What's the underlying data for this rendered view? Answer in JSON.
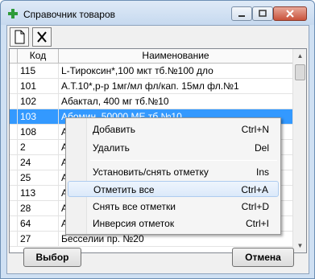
{
  "window": {
    "title": "Справочник товаров"
  },
  "toolbar": {
    "new_icon": "new-document-icon",
    "delete_icon": "delete-x-icon"
  },
  "grid": {
    "columns": [
      "Код",
      "Наименование"
    ],
    "rows": [
      {
        "code": "115",
        "name": "L-Тироксин*,100 мкт тб.№100 дло",
        "selected": false
      },
      {
        "code": "101",
        "name": "А.Т.10*,р-р 1мг/мл фл/кап. 15мл фл.№1",
        "selected": false
      },
      {
        "code": "102",
        "name": "Абактал, 400 мг тб.№10",
        "selected": false
      },
      {
        "code": "103",
        "name": "Абомин, 50000 МЕ тб.№10",
        "selected": true
      },
      {
        "code": "108",
        "name": "А",
        "selected": false
      },
      {
        "code": "2",
        "name": "А",
        "selected": false
      },
      {
        "code": "24",
        "name": "А",
        "selected": false
      },
      {
        "code": "25",
        "name": "А",
        "selected": false
      },
      {
        "code": "113",
        "name": "А",
        "selected": false
      },
      {
        "code": "28",
        "name": "А",
        "selected": false
      },
      {
        "code": "64",
        "name": "А",
        "selected": false
      },
      {
        "code": "27",
        "name": "Бесселии пр. №20",
        "selected": false
      }
    ]
  },
  "context_menu": {
    "items": [
      {
        "label": "Добавить",
        "shortcut": "Ctrl+N"
      },
      {
        "label": "Удалить",
        "shortcut": "Del"
      },
      {
        "label": "Установить/снять отметку",
        "shortcut": "Ins"
      },
      {
        "label": "Отметить все",
        "shortcut": "Ctrl+A",
        "highlighted": true
      },
      {
        "label": "Снять все отметки",
        "shortcut": "Ctrl+D"
      },
      {
        "label": "Инверсия отметок",
        "shortcut": "Ctrl+I"
      }
    ]
  },
  "buttons": {
    "select": "Выбор",
    "cancel": "Отмена"
  },
  "colors": {
    "selection": "#3399ff",
    "frame": "#cfe0f3"
  }
}
